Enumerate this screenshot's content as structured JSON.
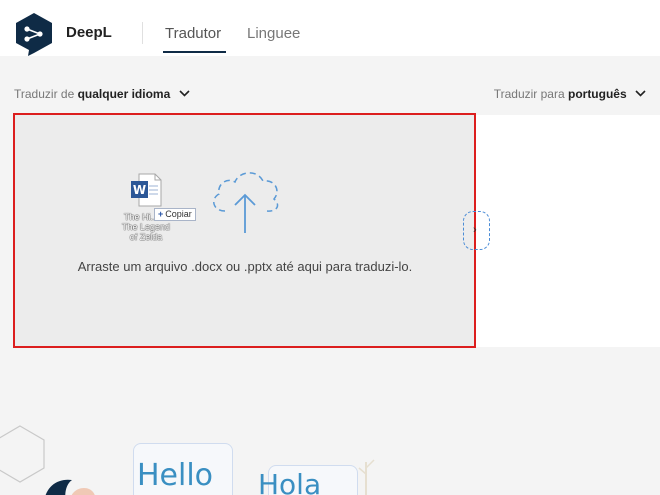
{
  "header": {
    "brand": "DeepL",
    "tabs": [
      {
        "label": "Tradutor",
        "active": true
      },
      {
        "label": "Linguee",
        "active": false
      }
    ]
  },
  "source_language": {
    "prefix": "Traduzir de",
    "value": "qualquer idioma"
  },
  "target_language": {
    "prefix": "Traduzir para",
    "value": "português"
  },
  "drop_zone": {
    "file_name": "The Hi... of The Legend of Zelda",
    "copy_badge": "Copiar",
    "instructions": "Arraste um arquivo .docx ou .pptx até aqui para traduzi-lo."
  },
  "illustration": {
    "bubble_left": "Hello",
    "bubble_right": "Hola"
  },
  "colors": {
    "brand_navy": "#0f2b46",
    "highlight_border": "#dc1e1e",
    "accent_blue": "#4b8cd6"
  }
}
